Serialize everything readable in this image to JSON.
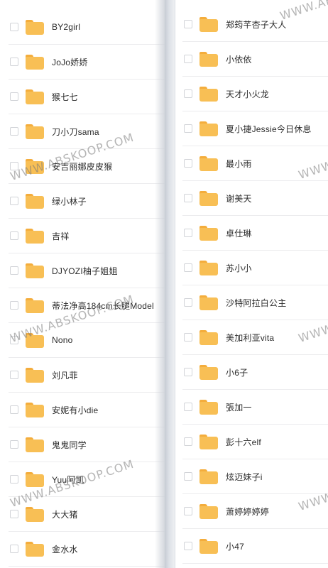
{
  "left_folders": [
    {
      "name": "BY2girl"
    },
    {
      "name": "JoJo娇娇"
    },
    {
      "name": "猴七七"
    },
    {
      "name": "刀小刀sama"
    },
    {
      "name": "安吉丽娜皮皮猴"
    },
    {
      "name": "绿小林子"
    },
    {
      "name": "吉祥"
    },
    {
      "name": "DJYOZI柚子姐姐"
    },
    {
      "name": "蒂法净高184cm长腿Model"
    },
    {
      "name": "Nono"
    },
    {
      "name": "刘凡菲"
    },
    {
      "name": "安妮有小die"
    },
    {
      "name": "鬼鬼同学"
    },
    {
      "name": "Yuu阿凯"
    },
    {
      "name": "大大猪"
    },
    {
      "name": "金水水"
    }
  ],
  "right_folders": [
    {
      "name": "郑筠芊杏子大人"
    },
    {
      "name": "小依依"
    },
    {
      "name": "天才小火龙"
    },
    {
      "name": "夏小捷Jessie今日休息"
    },
    {
      "name": "最小雨"
    },
    {
      "name": "谢美天"
    },
    {
      "name": "卓仕琳"
    },
    {
      "name": "苏小小"
    },
    {
      "name": "沙特阿拉白公主"
    },
    {
      "name": "美加利亚vita"
    },
    {
      "name": "小6子"
    },
    {
      "name": "張加一"
    },
    {
      "name": "彭十六elf"
    },
    {
      "name": "炫迈妹子i"
    },
    {
      "name": "萧婷婷婷婷"
    },
    {
      "name": "小47"
    }
  ],
  "watermark": "WWW.ABSKOOP.COM",
  "colors": {
    "folder_body": "#f8bf55",
    "folder_tab": "#f4ad3c",
    "text": "#2b2b2b",
    "divider": "#ececee"
  },
  "icons": {
    "folder": "folder-icon",
    "checkbox": "checkbox-icon"
  }
}
